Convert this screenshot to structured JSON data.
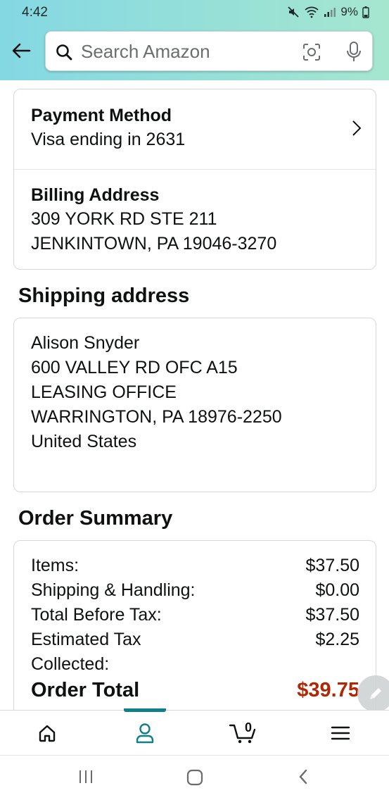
{
  "status_bar": {
    "time": "4:42",
    "battery": "9%"
  },
  "search": {
    "placeholder": "Search Amazon"
  },
  "payment": {
    "method_label": "Payment Method",
    "method_value": "Visa ending in 2631",
    "billing_label": "Billing Address",
    "billing_lines": [
      "309 YORK RD STE 211",
      "JENKINTOWN, PA 19046-3270"
    ]
  },
  "shipping": {
    "title": "Shipping address",
    "lines": [
      "Alison Snyder",
      "600 VALLEY RD OFC A15",
      "LEASING OFFICE",
      "WARRINGTON, PA 18976-2250",
      "United States"
    ]
  },
  "summary": {
    "title": "Order Summary",
    "rows": [
      {
        "label": "Items:",
        "value": "$37.50"
      },
      {
        "label": "Shipping & Handling:",
        "value": "$0.00"
      },
      {
        "label": "Total Before Tax:",
        "value": "$37.50"
      },
      {
        "label": "Estimated Tax",
        "label2": "Collected:",
        "value": "$2.25"
      }
    ],
    "total_label": "Order Total",
    "total_value": "$39.75"
  },
  "bottom_nav": {
    "cart_count": "0",
    "active": "account"
  },
  "colors": {
    "accent": "#0f7f8c",
    "price_red": "#b12704",
    "header_start": "#84d8e3",
    "header_end": "#a5e6cf"
  }
}
